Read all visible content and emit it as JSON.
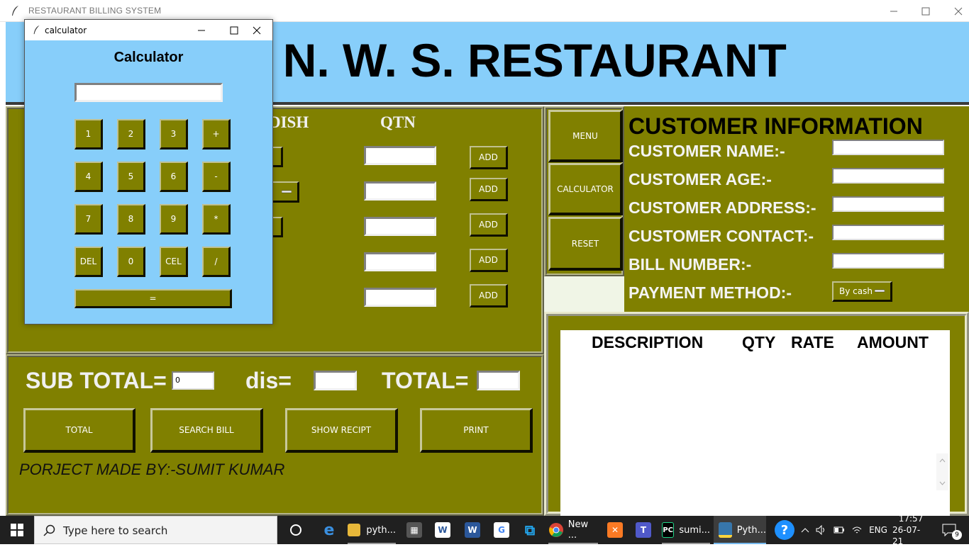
{
  "window": {
    "title": "RESTAURANT  BILLING SYSTEM"
  },
  "banner": {
    "title": "S. N. W. S. RESTAURANT"
  },
  "order": {
    "dish_header": "DISH",
    "qtn_header": "QTN",
    "add_label": "ADD"
  },
  "side_menu": {
    "menu": "MENU",
    "calculator": "CALCULATOR",
    "reset": "RESET"
  },
  "customer": {
    "heading": "CUSTOMER INFORMATION",
    "name_label": "CUSTOMER NAME:-",
    "age_label": "CUSTOMER AGE:-",
    "address_label": "CUSTOMER ADDRESS:-",
    "contact_label": "CUSTOMER CONTACT:-",
    "bill_label": "BILL NUMBER:-",
    "payment_label": "PAYMENT METHOD:-",
    "payment_value": "By cash"
  },
  "receipt": {
    "description": "DESCRIPTION",
    "qty": "QTY",
    "rate": "RATE",
    "amount": "AMOUNT"
  },
  "totals": {
    "subtotal_label": "SUB TOTAL=",
    "subtotal_value": "0",
    "dis_label": "dis=",
    "total_label": "TOTAL="
  },
  "actions": {
    "total": "TOTAL",
    "search_bill": "SEARCH BILL",
    "show_recipt": "SHOW RECIPT",
    "print": "PRINT"
  },
  "credit": "PORJECT MADE BY:-SUMIT KUMAR",
  "calculator": {
    "window_title": "calculator",
    "heading": "Calculator",
    "keys": [
      "1",
      "2",
      "3",
      "+",
      "4",
      "5",
      "6",
      "-",
      "7",
      "8",
      "9",
      "*",
      "DEL",
      "0",
      "CEL",
      "/"
    ],
    "equals": "="
  },
  "taskbar": {
    "search_placeholder": "Type here to search",
    "apps": {
      "explorer": "pyth...",
      "chrome": "New ...",
      "pycharm": "sumi...",
      "python": "Pyth..."
    },
    "language": "ENG",
    "time": "17:57",
    "date": "26-07-21",
    "notification_count": "9"
  }
}
